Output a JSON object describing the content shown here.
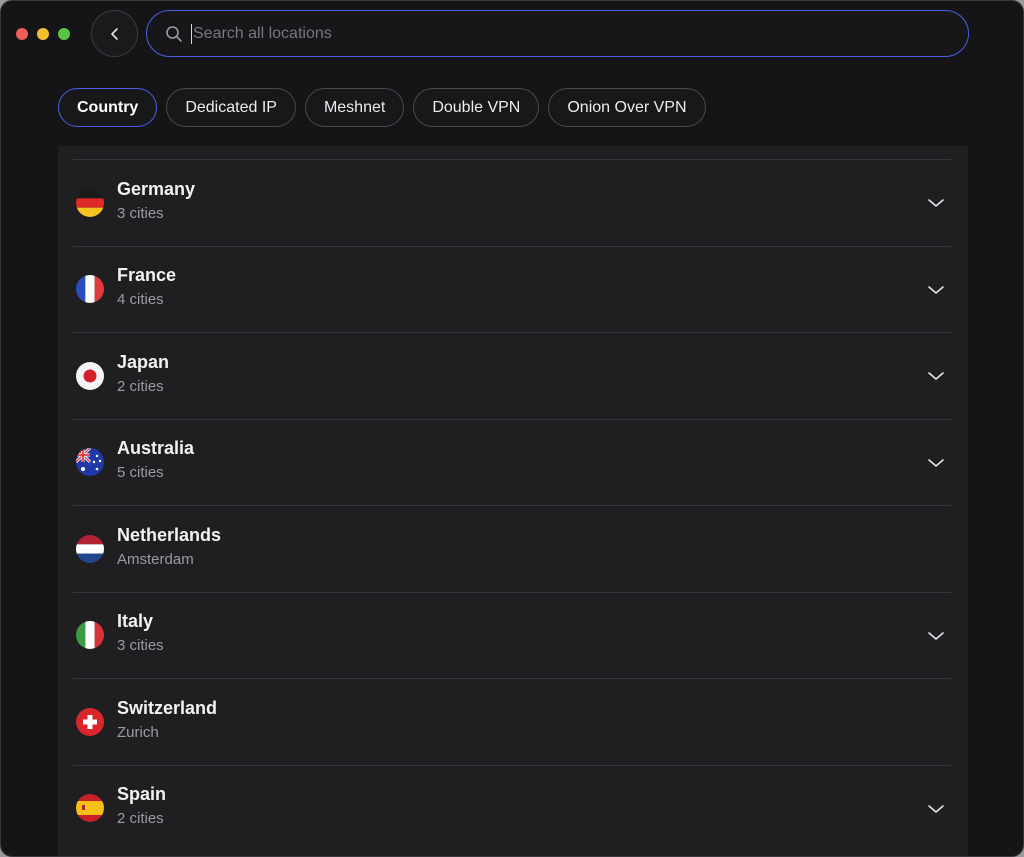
{
  "search": {
    "placeholder": "Search all locations"
  },
  "tabs": [
    {
      "label": "Country",
      "active": true
    },
    {
      "label": "Dedicated IP"
    },
    {
      "label": "Meshnet"
    },
    {
      "label": "Double VPN"
    },
    {
      "label": "Onion Over VPN"
    }
  ],
  "countries": [
    {
      "name": "Germany",
      "sub": "3 cities",
      "expandable": true,
      "flag": "germany-flag-icon"
    },
    {
      "name": "France",
      "sub": "4 cities",
      "expandable": true,
      "flag": "france-flag-icon"
    },
    {
      "name": "Japan",
      "sub": "2 cities",
      "expandable": true,
      "flag": "japan-flag-icon"
    },
    {
      "name": "Australia",
      "sub": "5 cities",
      "expandable": true,
      "flag": "australia-flag-icon"
    },
    {
      "name": "Netherlands",
      "sub": "Amsterdam",
      "expandable": false,
      "flag": "netherlands-flag-icon"
    },
    {
      "name": "Italy",
      "sub": "3 cities",
      "expandable": true,
      "flag": "italy-flag-icon"
    },
    {
      "name": "Switzerland",
      "sub": "Zurich",
      "expandable": false,
      "flag": "switzerland-flag-icon"
    },
    {
      "name": "Spain",
      "sub": "2 cities",
      "expandable": true,
      "flag": "spain-flag-icon"
    }
  ],
  "colors": {
    "accent": "#4a5ee8",
    "background": "#151517",
    "panel": "#1f1f22"
  }
}
